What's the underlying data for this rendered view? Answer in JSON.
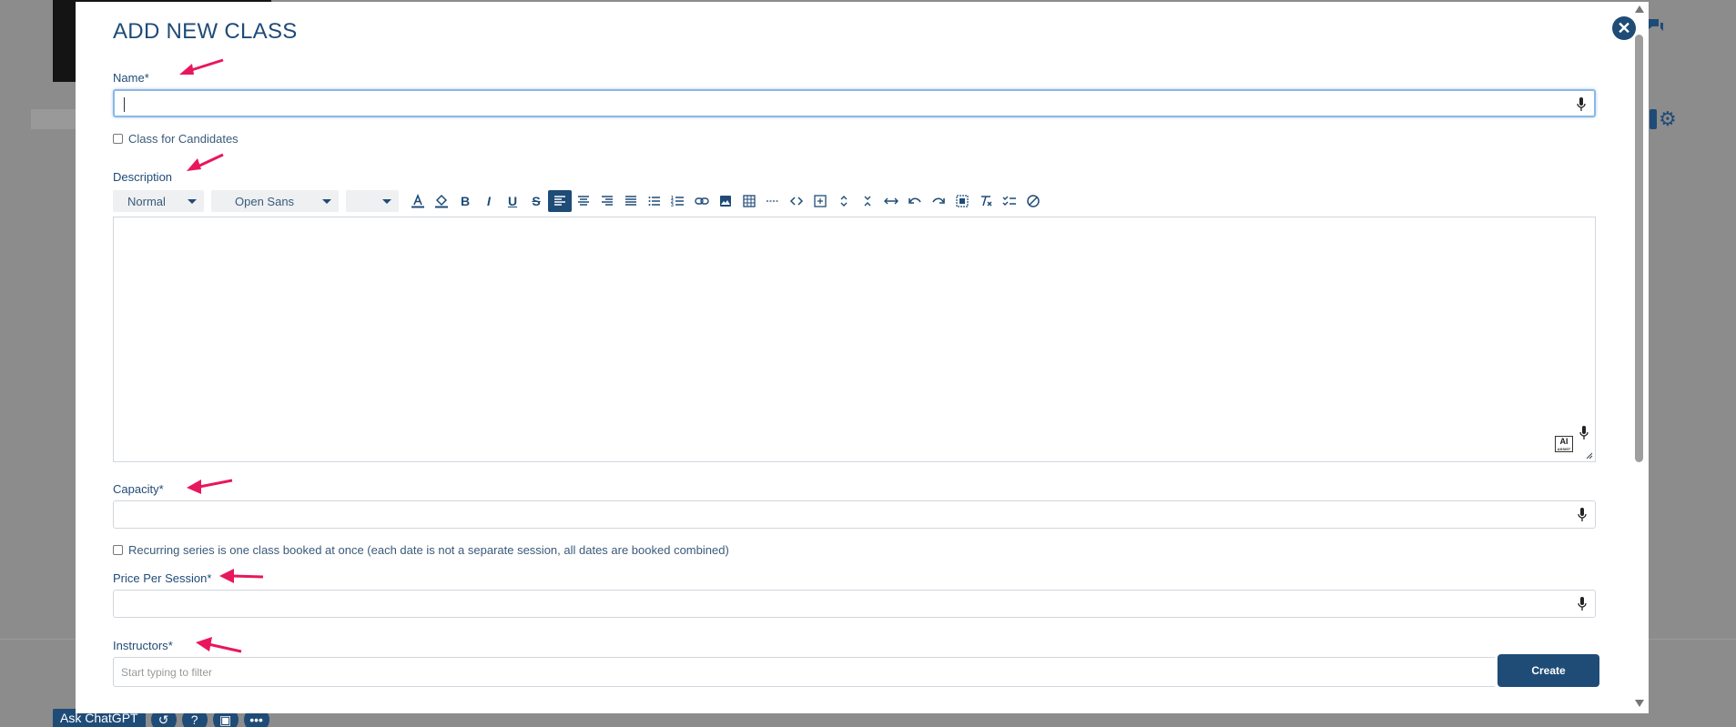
{
  "background": {
    "bottom_bar": {
      "ask_label": "Ask ChatGPT",
      "icons": [
        "history-icon",
        "help-icon",
        "save-icon",
        "more-icon"
      ]
    }
  },
  "modal": {
    "title": "ADD NEW CLASS",
    "close_symbol": "✕",
    "fields": {
      "name": {
        "label": "Name",
        "required": "*",
        "value": ""
      },
      "class_for_candidates": {
        "label": "Class for Candidates",
        "checked": false
      },
      "description": {
        "label": "Description"
      },
      "capacity": {
        "label": "Capacity",
        "required": "*",
        "value": ""
      },
      "recurring": {
        "label": "Recurring series is one class booked at once (each date is not a separate session, all dates are booked combined)",
        "checked": false
      },
      "price": {
        "label": "Price Per Session",
        "required": "*",
        "value": ""
      },
      "instructors": {
        "label": "Instructors",
        "required": "*",
        "placeholder": "Start typing to filter"
      }
    },
    "toolbar": {
      "style_select": "Normal",
      "font_select": "Open Sans",
      "size_select": ""
    },
    "editor": {
      "ai_badge": "AI",
      "ai_badge_sub": "ASSIST"
    },
    "create_label": "Create"
  },
  "colors": {
    "accent": "#1f4b77",
    "annotation": "#e8175d"
  }
}
